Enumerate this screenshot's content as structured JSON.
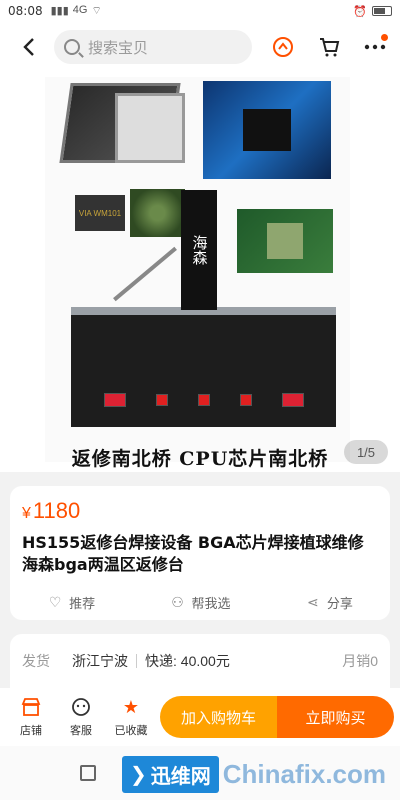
{
  "status_bar": {
    "time": "08:08",
    "signal_text": "4G",
    "icons": [
      "signal-icon",
      "wifi-icon",
      "alarm-icon",
      "battery-icon"
    ]
  },
  "top_bar": {
    "search_placeholder": "搜索宝贝",
    "icons": [
      "back-icon",
      "share-icon",
      "cart-icon",
      "more-icon"
    ]
  },
  "gallery": {
    "overlay_text": "返修南北桥 CPU芯片南北桥",
    "machine_label": "海森",
    "chip_label": "VIA WM101",
    "counter": "1/5"
  },
  "product": {
    "currency": "¥",
    "price": "1180",
    "title": "HS155返修台焊接设备 BGA芯片焊接植球维修 海森bga两温区返修台",
    "actions": [
      {
        "label": "推荐",
        "icon": "heart-icon"
      },
      {
        "label": "帮我选",
        "icon": "people-icon"
      },
      {
        "label": "分享",
        "icon": "share-icon"
      }
    ]
  },
  "shipping": {
    "label": "发货",
    "origin": "浙江宁波",
    "delivery": "快递: 40.00元",
    "sales": "月销0"
  },
  "bottom_bar": {
    "items": [
      {
        "label": "店铺",
        "icon": "store-icon"
      },
      {
        "label": "客服",
        "icon": "chat-icon"
      },
      {
        "label": "已收藏",
        "icon": "star-icon"
      }
    ],
    "add_to_cart": "加入购物车",
    "buy_now": "立即购买"
  },
  "watermark": {
    "brand": "迅维网",
    "site": "Chinafix.com"
  },
  "colors": {
    "accent": "#ff5000",
    "cart_button": "#ffa200",
    "buy_button": "#ff6a00",
    "watermark_blue": "#1e88d8"
  }
}
